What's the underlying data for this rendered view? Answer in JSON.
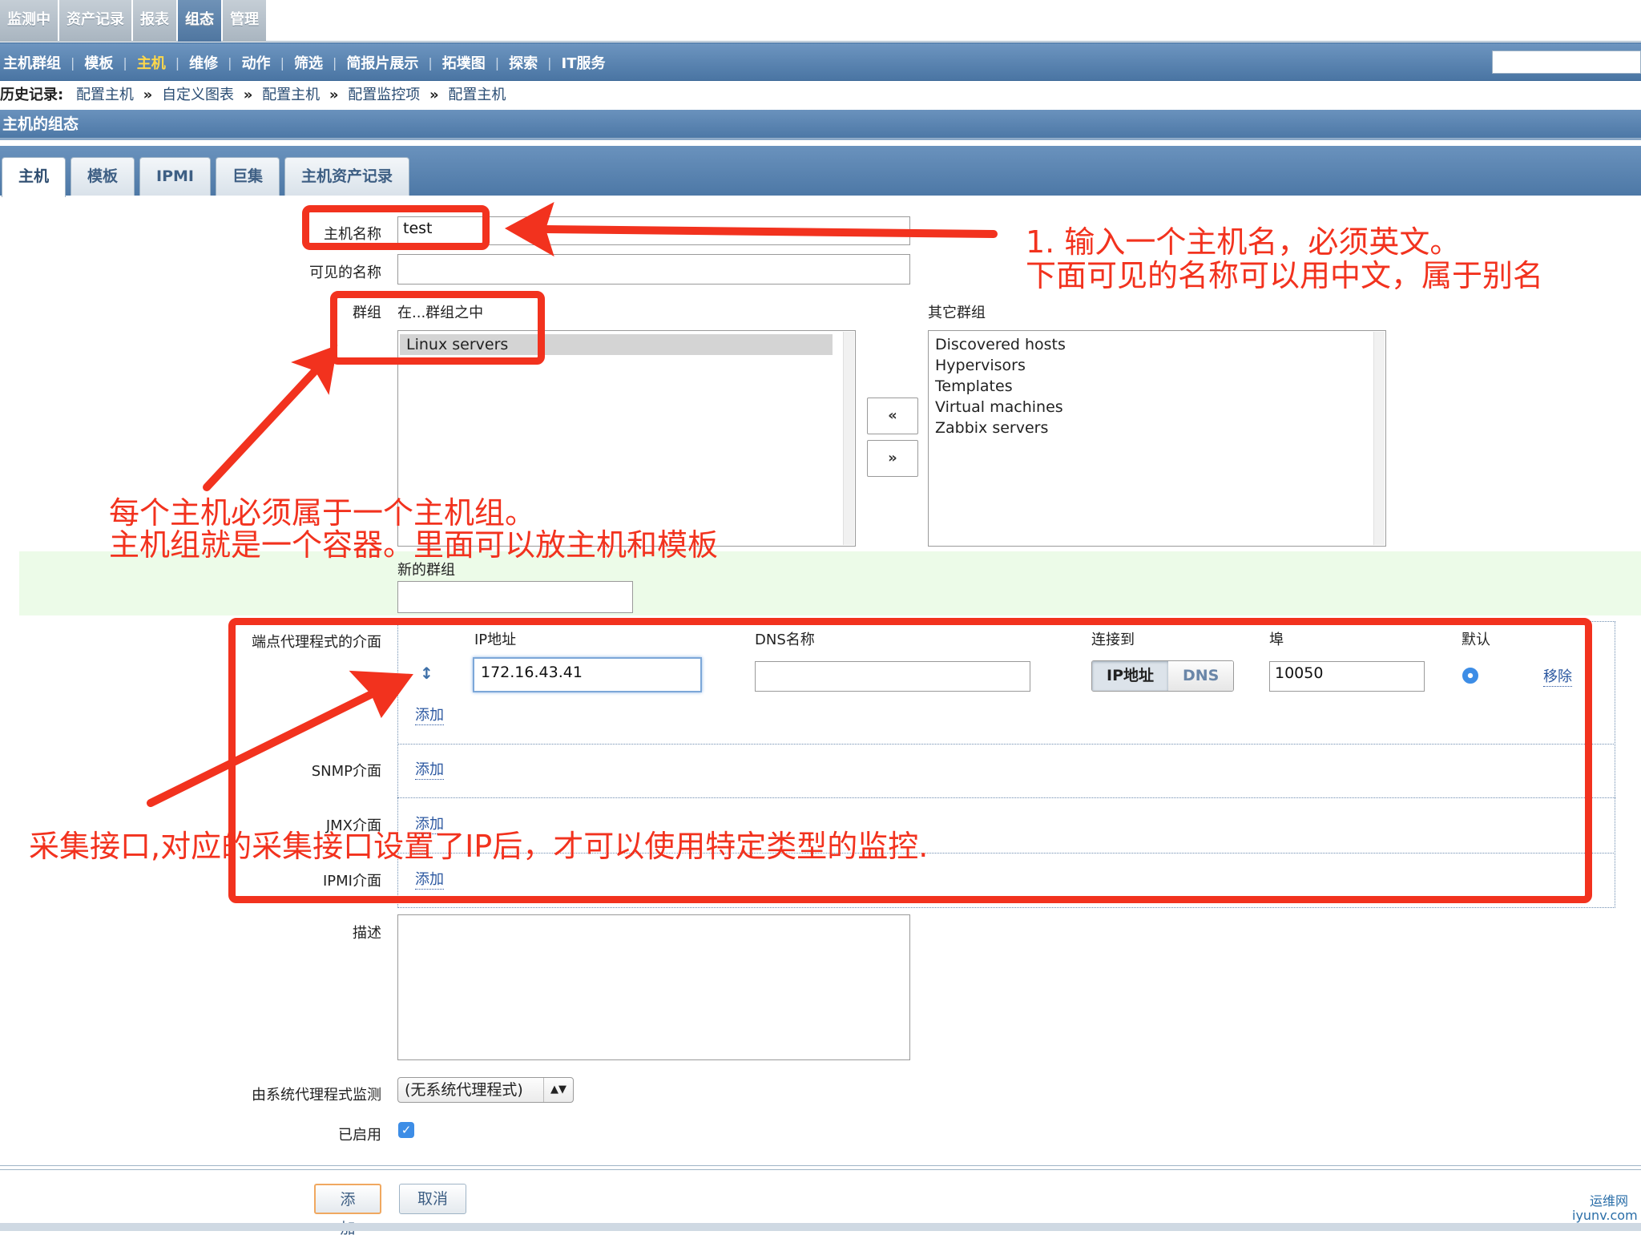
{
  "top_menu": [
    {
      "label": "监测中",
      "active": false
    },
    {
      "label": "资产记录",
      "active": false
    },
    {
      "label": "报表",
      "active": false
    },
    {
      "label": "组态",
      "active": true
    },
    {
      "label": "管理",
      "active": false
    }
  ],
  "sub_menu": [
    {
      "label": "主机群组",
      "active": false
    },
    {
      "label": "模板",
      "active": false
    },
    {
      "label": "主机",
      "active": true
    },
    {
      "label": "维修",
      "active": false
    },
    {
      "label": "动作",
      "active": false
    },
    {
      "label": "筛选",
      "active": false
    },
    {
      "label": "简报片展示",
      "active": false
    },
    {
      "label": "拓墣图",
      "active": false
    },
    {
      "label": "探索",
      "active": false
    },
    {
      "label": "IT服务",
      "active": false
    }
  ],
  "history": {
    "label": "历史记录:",
    "items": [
      "配置主机",
      "自定义图表",
      "配置主机",
      "配置监控项",
      "配置主机"
    ],
    "separator": "»"
  },
  "page_title": "主机的组态",
  "tabs": [
    {
      "label": "主机",
      "active": true
    },
    {
      "label": "模板",
      "active": false
    },
    {
      "label": "IPMI",
      "active": false
    },
    {
      "label": "巨集",
      "active": false
    },
    {
      "label": "主机资产记录",
      "active": false
    }
  ],
  "form": {
    "host_name_label": "主机名称",
    "host_name_value": "test",
    "visible_name_label": "可见的名称",
    "visible_name_value": "",
    "groups_label": "群组",
    "in_groups_label": "在...群组之中",
    "in_groups": [
      "Linux servers"
    ],
    "other_groups_label": "其它群组",
    "other_groups": [
      "Discovered hosts",
      "Hypervisors",
      "Templates",
      "Virtual machines",
      "Zabbix servers"
    ],
    "move_left": "«",
    "move_right": "»",
    "new_group_label": "新的群组",
    "new_group_value": "",
    "agent_interfaces_label": "端点代理程式的介面",
    "col_ip": "IP地址",
    "col_dns": "DNS名称",
    "col_connect": "连接到",
    "col_port": "埠",
    "col_default": "默认",
    "ip_value": "172.16.43.41",
    "dns_value": "",
    "connect_ip": "IP地址",
    "connect_dns": "DNS",
    "port_value": "10050",
    "remove_link": "移除",
    "add_link": "添加",
    "snmp_label": "SNMP介面",
    "jmx_label": "JMX介面",
    "ipmi_label": "IPMI介面",
    "description_label": "描述",
    "description_value": "",
    "proxy_label": "由系统代理程式监测",
    "proxy_value": "(无系统代理程式)",
    "enabled_label": "已启用",
    "enabled": true
  },
  "buttons": {
    "add": "添加",
    "cancel": "取消"
  },
  "annotations": {
    "a1_line1": "1. 输入一个主机名，必须英文。",
    "a1_line2": "下面可见的名称可以用中文，属于别名",
    "a2_line1": "每个主机必须属于一个主机组。",
    "a2_line2": "主机组就是一个容器。里面可以放主机和模板",
    "a3": "采集接口,对应的采集接口设置了IP后，才可以使用特定类型的监控."
  },
  "watermark": {
    "line1": "运维网",
    "line2": "iyunv.com"
  },
  "colors": {
    "annotation_red": "#f2321e",
    "header_blue": "#4d78a6",
    "active_menu_yellow": "#ffd84a"
  }
}
